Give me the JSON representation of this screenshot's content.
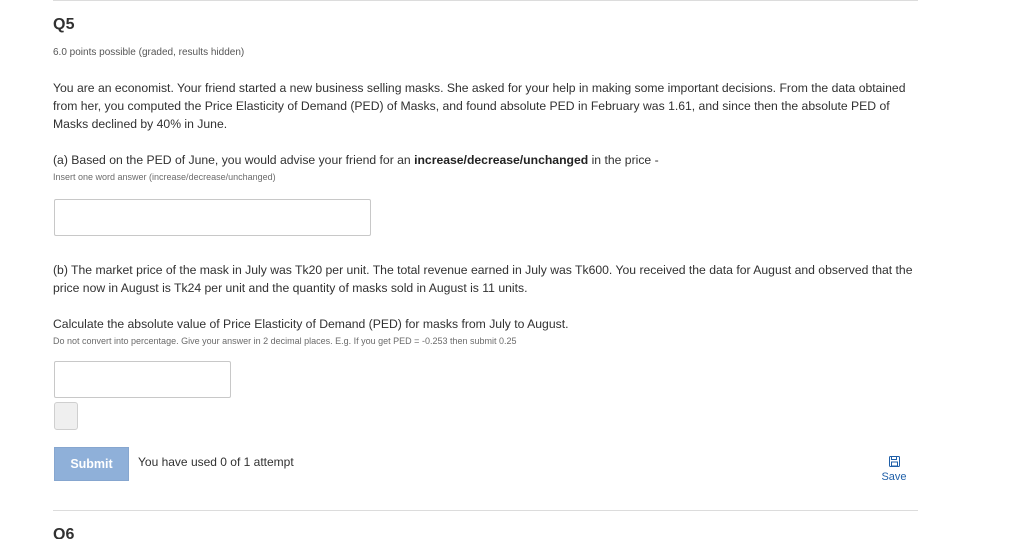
{
  "question": {
    "title": "Q5",
    "points": "6.0 points possible (graded, results hidden)",
    "intro": "You are an economist. Your friend started a new business selling masks. She asked for your help in making some important decisions. From the data obtained from her, you computed the Price Elasticity of Demand (PED) of Masks, and found absolute PED in February was 1.61, and since then the absolute PED of Masks declined by 40% in June."
  },
  "part_a": {
    "prefix": "(a) Based on the PED of June, you would advise your friend for an ",
    "bold": "increase/decrease/unchanged",
    "suffix": " in the price -",
    "hint": "Insert one word answer (increase/decrease/unchanged)",
    "value": ""
  },
  "part_b": {
    "text": "(b) The market price of the mask in July was Tk20 per unit. The total revenue earned in July was Tk600. You received the data for August and observed that the price now in August is Tk24 per unit and the quantity of masks sold in August is 11 units.",
    "calc": "Calculate the absolute value of Price Elasticity of Demand (PED) for masks from July to August.",
    "hint": "Do not convert into percentage. Give your answer in 2 decimal places. E.g. If you get PED = -0.253 then submit 0.25",
    "value": ""
  },
  "actions": {
    "submit_label": "Submit",
    "attempts": "You have used 0 of 1 attempt",
    "save_label": "Save",
    "save_icon": "floppy-disk-icon"
  },
  "next_question": {
    "title": "Q6"
  },
  "colors": {
    "submit_bg": "#8fb0d9",
    "link": "#1f5fa8",
    "divider": "#dcdcdc"
  }
}
